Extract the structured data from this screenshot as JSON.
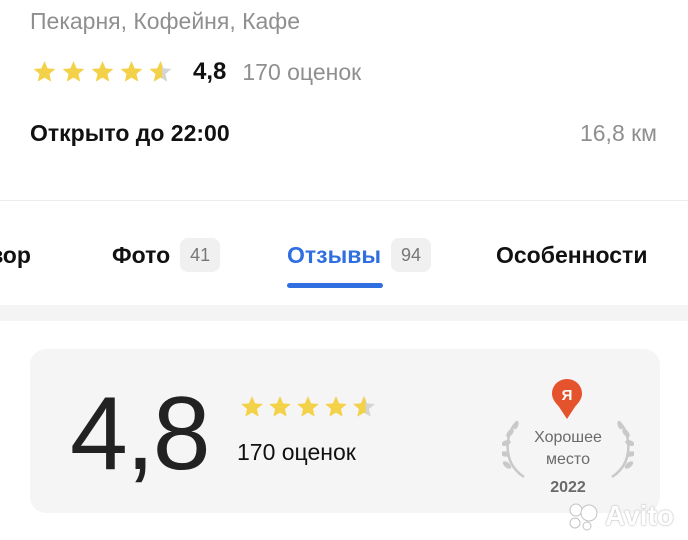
{
  "header": {
    "category": "Пекарня, Кофейня, Кафе",
    "rating_value": 4.8,
    "rating_text": "4,8",
    "rating_count": "170 оценок",
    "hours": "Открыто до 22:00",
    "distance": "16,8 км"
  },
  "tabs": [
    {
      "label": "Обзор",
      "visible_label": "бзор",
      "count": ""
    },
    {
      "label": "Фото",
      "count": "41"
    },
    {
      "label": "Отзывы",
      "count": "94",
      "active": true
    },
    {
      "label": "Особенности",
      "count": ""
    }
  ],
  "summary": {
    "rating_text": "4,8",
    "rating_value": 4.8,
    "count": "170 оценок",
    "badge": {
      "logo_letter": "Я",
      "label": "Хорошее место",
      "year": "2022"
    }
  },
  "watermark": {
    "text": "Avito"
  },
  "colors": {
    "star": "#f3d249",
    "star_empty": "#d4d4d4",
    "accent": "#2f6fe0",
    "muted_text": "#8f8f8f",
    "card_bg": "#f5f5f5",
    "pin": "#e5532d"
  },
  "icons": [
    "star-icon",
    "star-half-icon",
    "yandex-pin-icon",
    "laurel-icon",
    "avito-logo-icon"
  ]
}
